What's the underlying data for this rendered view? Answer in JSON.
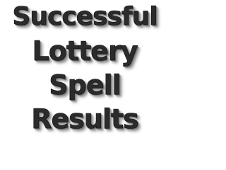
{
  "heading": {
    "line1": "Successful",
    "line2": "Lottery",
    "line3": "Spell",
    "line4": "Results"
  },
  "colors": {
    "text": "#2b2b2b",
    "shadow": "#8a8a8a",
    "background": "#ffffff"
  }
}
